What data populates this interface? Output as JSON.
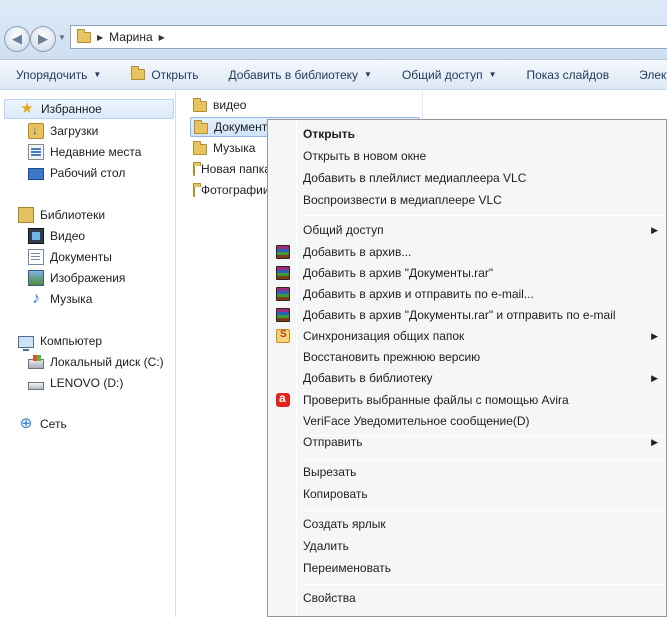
{
  "address": {
    "breadcrumb": "Марина"
  },
  "toolbar": {
    "organize": "Упорядочить",
    "open": "Открыть",
    "add_library": "Добавить в библиотеку",
    "share": "Общий доступ",
    "slideshow": "Показ слайдов",
    "more": "Элект"
  },
  "nav": {
    "favorites": "Избранное",
    "downloads": "Загрузки",
    "recent": "Недавние места",
    "desktop": "Рабочий стол",
    "libraries": "Библиотеки",
    "videos": "Видео",
    "documents": "Документы",
    "pictures": "Изображения",
    "music": "Музыка",
    "computer": "Компьютер",
    "local_disk": "Локальный диск (C:)",
    "lenovo": "LENOVO (D:)",
    "network": "Сеть"
  },
  "files": [
    {
      "name": "видео"
    },
    {
      "name": "Документы"
    },
    {
      "name": "Музыка"
    },
    {
      "name": "Новая папка"
    },
    {
      "name": "Фотографии"
    }
  ],
  "context_menu": {
    "open": "Открыть",
    "open_new_window": "Открыть в новом окне",
    "vlc_playlist": "Добавить в плейлист медиаплеера VLC",
    "vlc_play": "Воспроизвести в медиаплеере VLC",
    "share": "Общий доступ",
    "add_archive": "Добавить в архив...",
    "add_archive_named": "Добавить в архив \"Документы.rar\"",
    "add_archive_email": "Добавить в архив и отправить по e-mail...",
    "add_archive_named_email": "Добавить в архив \"Документы.rar\" и отправить по e-mail",
    "sync": "Синхронизация общих папок",
    "restore": "Восстановить прежнюю версию",
    "add_library": "Добавить в библиотеку",
    "avira": "Проверить выбранные файлы с помощью Avira",
    "veriface": "VeriFace Уведомительное сообщение(D)",
    "send_to": "Отправить",
    "cut": "Вырезать",
    "copy": "Копировать",
    "shortcut": "Создать ярлык",
    "delete": "Удалить",
    "rename": "Переименовать",
    "properties": "Свойства"
  }
}
